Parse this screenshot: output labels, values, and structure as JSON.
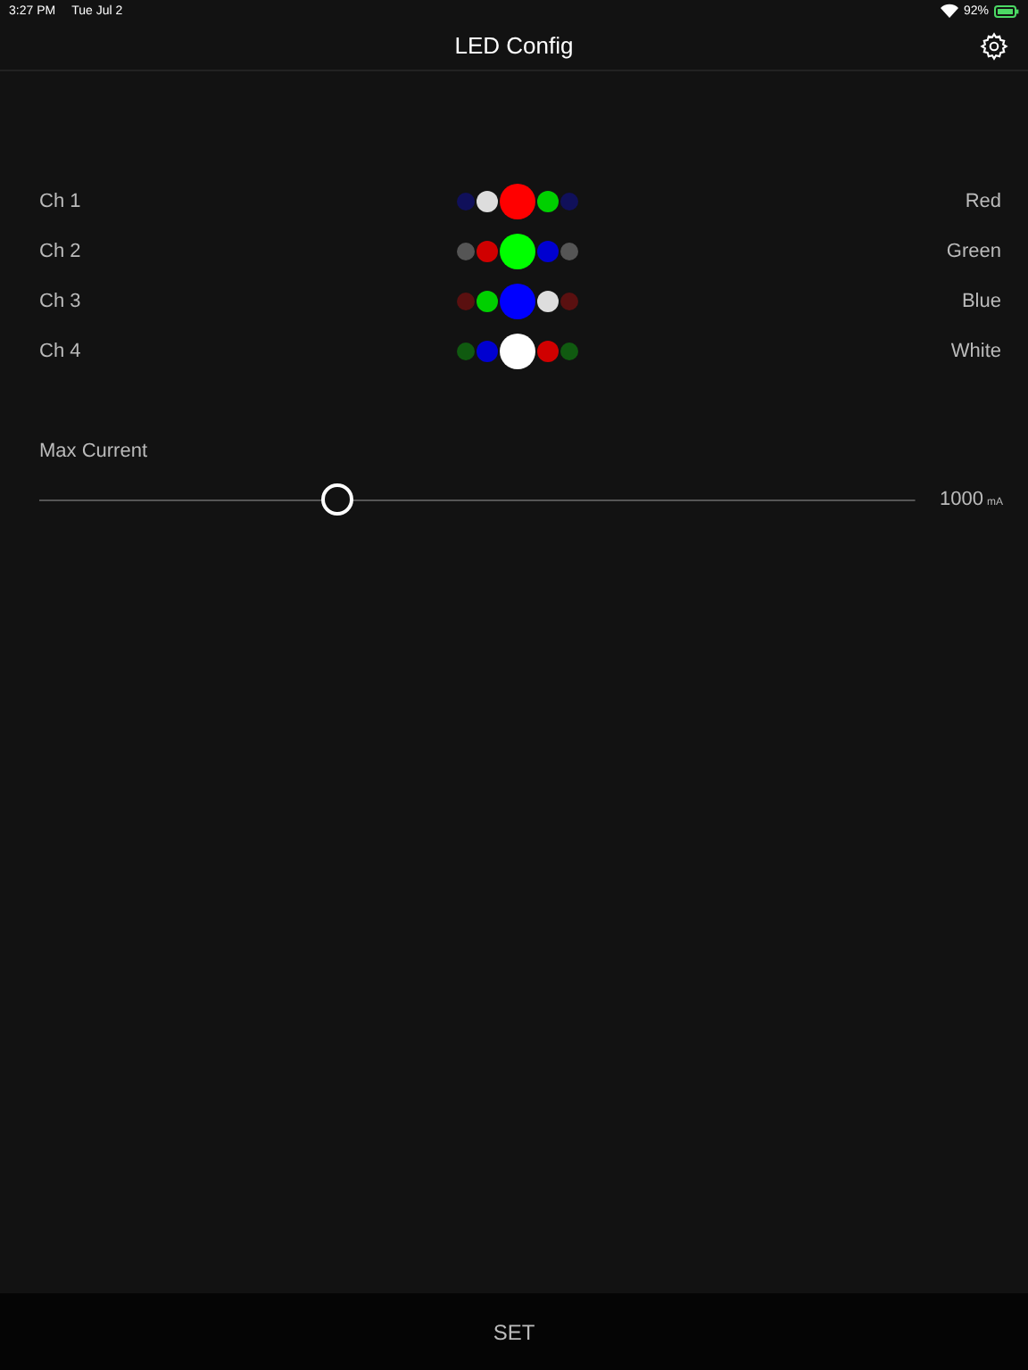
{
  "status_bar": {
    "time": "3:27 PM",
    "date": "Tue Jul 2",
    "battery": "92%"
  },
  "nav_bar": {
    "title": "LED Config"
  },
  "channels": [
    {
      "label": "Ch 1",
      "color_name": "Red",
      "dots": [
        {
          "kind": "edge",
          "color": "#10105a"
        },
        {
          "kind": "side",
          "color": "#dddddd"
        },
        {
          "kind": "center",
          "color": "#ff0000"
        },
        {
          "kind": "side",
          "color": "#00d000"
        },
        {
          "kind": "edge",
          "color": "#10105a"
        }
      ]
    },
    {
      "label": "Ch 2",
      "color_name": "Green",
      "dots": [
        {
          "kind": "edge",
          "color": "#555555"
        },
        {
          "kind": "side",
          "color": "#d00000"
        },
        {
          "kind": "center",
          "color": "#00ff00"
        },
        {
          "kind": "side",
          "color": "#0000d0"
        },
        {
          "kind": "edge",
          "color": "#555555"
        }
      ]
    },
    {
      "label": "Ch 3",
      "color_name": "Blue",
      "dots": [
        {
          "kind": "edge",
          "color": "#5a1010"
        },
        {
          "kind": "side",
          "color": "#00d000"
        },
        {
          "kind": "center",
          "color": "#0000ff"
        },
        {
          "kind": "side",
          "color": "#dddddd"
        },
        {
          "kind": "edge",
          "color": "#5a1010"
        }
      ]
    },
    {
      "label": "Ch 4",
      "color_name": "White",
      "dots": [
        {
          "kind": "edge",
          "color": "#105a10"
        },
        {
          "kind": "side",
          "color": "#0000d0"
        },
        {
          "kind": "center",
          "color": "#ffffff"
        },
        {
          "kind": "side",
          "color": "#d00000"
        },
        {
          "kind": "edge",
          "color": "#105a10"
        }
      ]
    }
  ],
  "max_current": {
    "label": "Max Current",
    "level": 0.34,
    "value": "1000",
    "unit": "mA"
  },
  "bottom_bar": {
    "button": "SET"
  }
}
